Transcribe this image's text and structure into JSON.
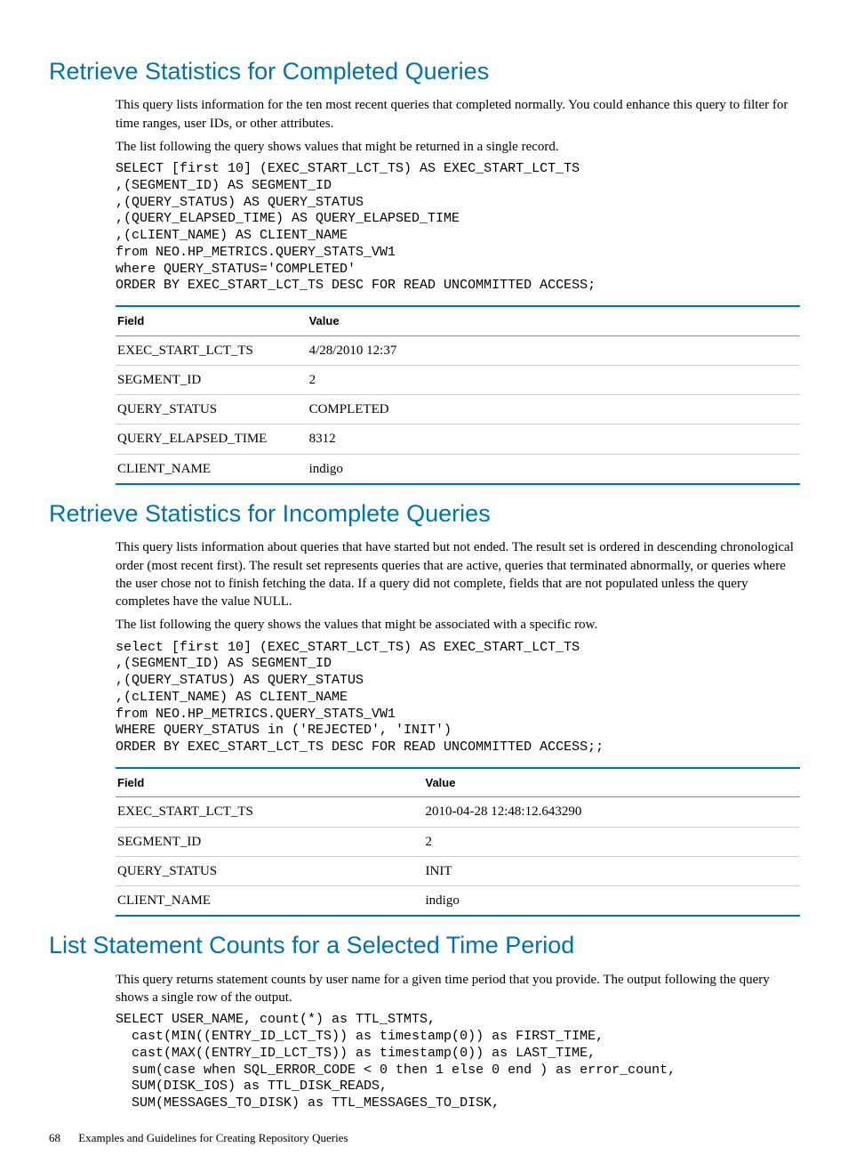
{
  "section1": {
    "heading": "Retrieve Statistics for Completed Queries",
    "para1": "This query lists information for the ten most recent queries that completed normally. You could enhance this query to filter for time ranges, user IDs, or other attributes.",
    "para2": "The list following the query shows values that might be returned in a single record.",
    "code": "SELECT [first 10] (EXEC_START_LCT_TS) AS EXEC_START_LCT_TS\n,(SEGMENT_ID) AS SEGMENT_ID\n,(QUERY_STATUS) AS QUERY_STATUS\n,(QUERY_ELAPSED_TIME) AS QUERY_ELAPSED_TIME\n,(cLIENT_NAME) AS CLIENT_NAME\nfrom NEO.HP_METRICS.QUERY_STATS_VW1\nwhere QUERY_STATUS='COMPLETED'\nORDER BY EXEC_START_LCT_TS DESC FOR READ UNCOMMITTED ACCESS;",
    "table": {
      "hField": "Field",
      "hValue": "Value",
      "rows": [
        {
          "f": "EXEC_START_LCT_TS",
          "v": "4/28/2010 12:37"
        },
        {
          "f": "SEGMENT_ID",
          "v": "2"
        },
        {
          "f": "QUERY_STATUS",
          "v": "COMPLETED"
        },
        {
          "f": "QUERY_ELAPSED_TIME",
          "v": "8312"
        },
        {
          "f": "CLIENT_NAME",
          "v": "indigo"
        }
      ]
    }
  },
  "section2": {
    "heading": "Retrieve Statistics for Incomplete Queries",
    "para1": "This query lists information about queries that have started but not ended. The result set is ordered in descending chronological order (most recent first). The result set represents queries that are active, queries that terminated abnormally, or queries where the user chose not to finish fetching the data. If a query did not complete, fields that are not populated unless the query completes have the value NULL.",
    "para2": "The list following the query shows the values that might be associated with a specific row.",
    "code": "select [first 10] (EXEC_START_LCT_TS) AS EXEC_START_LCT_TS\n,(SEGMENT_ID) AS SEGMENT_ID\n,(QUERY_STATUS) AS QUERY_STATUS\n,(cLIENT_NAME) AS CLIENT_NAME\nfrom NEO.HP_METRICS.QUERY_STATS_VW1\nWHERE QUERY_STATUS in ('REJECTED', 'INIT')\nORDER BY EXEC_START_LCT_TS DESC FOR READ UNCOMMITTED ACCESS;;",
    "table": {
      "hField": "Field",
      "hValue": "Value",
      "rows": [
        {
          "f": "EXEC_START_LCT_TS",
          "v": "2010-04-28 12:48:12.643290"
        },
        {
          "f": "SEGMENT_ID",
          "v": "2"
        },
        {
          "f": "QUERY_STATUS",
          "v": "INIT"
        },
        {
          "f": "CLIENT_NAME",
          "v": "indigo"
        }
      ]
    }
  },
  "section3": {
    "heading": "List Statement Counts for a Selected Time Period",
    "para1": "This query returns statement counts by user name for a given time period that you provide. The output following the query shows a single row of the output.",
    "code": "SELECT USER_NAME, count(*) as TTL_STMTS,\n  cast(MIN((ENTRY_ID_LCT_TS)) as timestamp(0)) as FIRST_TIME,\n  cast(MAX((ENTRY_ID_LCT_TS)) as timestamp(0)) as LAST_TIME,\n  sum(case when SQL_ERROR_CODE < 0 then 1 else 0 end ) as error_count,\n  SUM(DISK_IOS) as TTL_DISK_READS,\n  SUM(MESSAGES_TO_DISK) as TTL_MESSAGES_TO_DISK,"
  },
  "footer": {
    "page": "68",
    "text": "Examples and Guidelines for Creating Repository Queries"
  }
}
